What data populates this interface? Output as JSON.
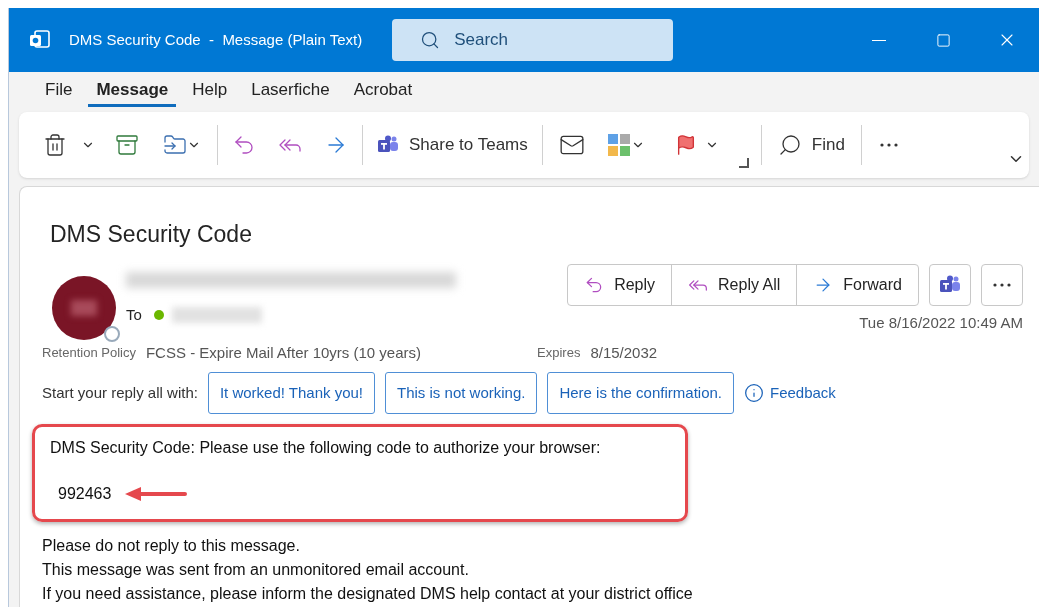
{
  "window": {
    "title": "DMS Security Code  -  Message (Plain Text)"
  },
  "search": {
    "placeholder": "Search"
  },
  "menu_tabs": [
    {
      "label": "File",
      "selected": false
    },
    {
      "label": "Message",
      "selected": true
    },
    {
      "label": "Help",
      "selected": false
    },
    {
      "label": "Laserfiche",
      "selected": false
    },
    {
      "label": "Acrobat",
      "selected": false
    }
  ],
  "ribbon": {
    "share_label": "Share to Teams",
    "find_label": "Find"
  },
  "message": {
    "subject": "DMS Security Code",
    "to_label": "To",
    "date": "Tue 8/16/2022 10:49 AM",
    "retention_label": "Retention Policy",
    "retention_value": "FCSS - Expire Mail After 10yrs (10 years)",
    "expires_label": "Expires",
    "expires_value": "8/15/2032",
    "actions": [
      "Reply",
      "Reply All",
      "Forward"
    ],
    "suggest_prompt": "Start your reply all with:",
    "suggestions": [
      "It worked! Thank you!",
      "This is not working.",
      "Here is the confirmation."
    ],
    "feedback": "Feedback",
    "highlight_line": "DMS Security Code: Please use the following code to authorize your browser:",
    "code": "992463",
    "body": [
      "Please do not reply to this message.",
      "This message was sent from an unmonitored email account.",
      "If you need assistance, please inform the designated DMS help contact at your district office"
    ]
  }
}
